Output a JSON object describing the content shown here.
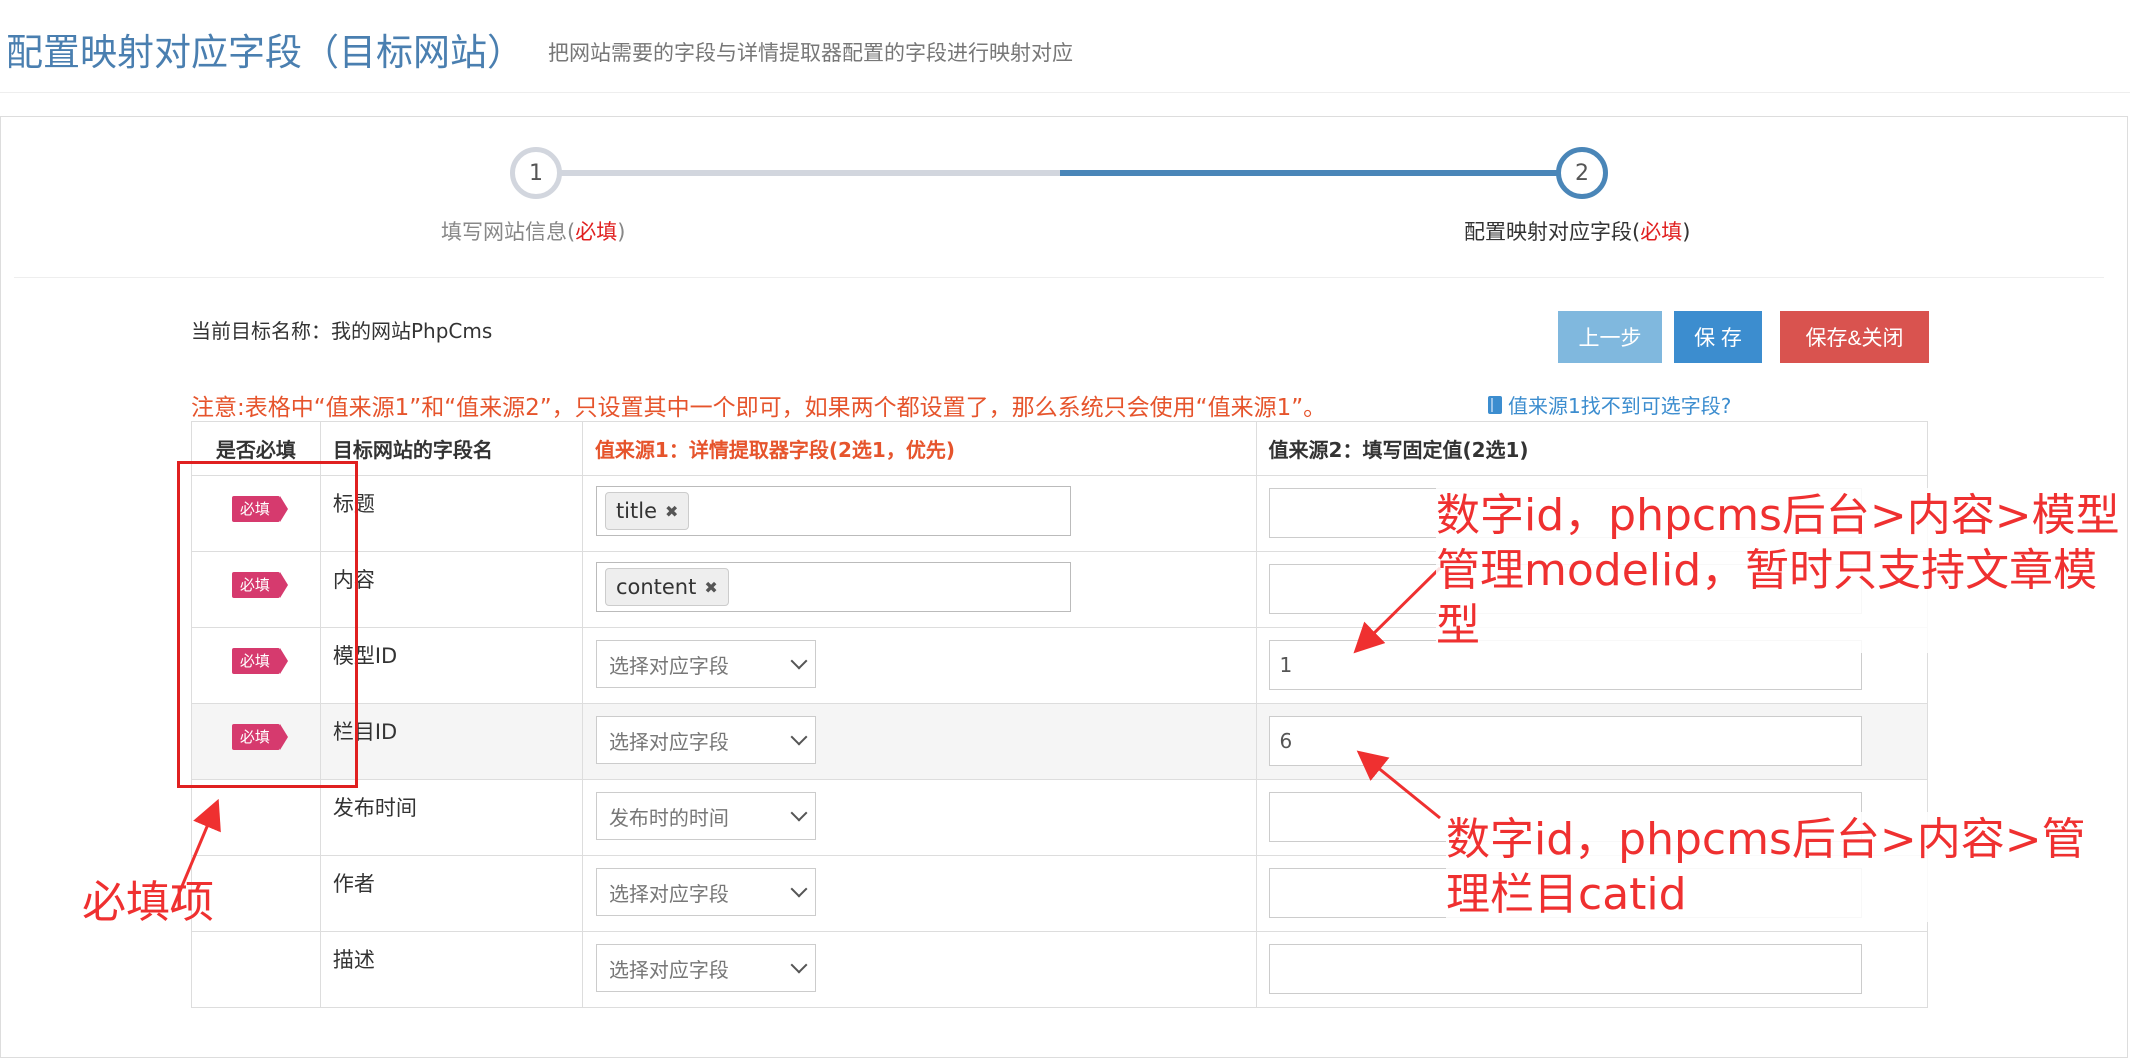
{
  "header": {
    "title": "配置映射对应字段（目标网站）",
    "subtitle": "把网站需要的字段与详情提取器配置的字段进行映射对应"
  },
  "wizard": {
    "steps": [
      {
        "number": "1",
        "label": "填写网站信息(",
        "required": "必填",
        "close": ")"
      },
      {
        "number": "2",
        "label": "配置映射对应字段(",
        "required": "必填",
        "close": ")"
      }
    ]
  },
  "target_name": "当前目标名称：我的网站PhpCms",
  "buttons": {
    "prev": "上一步",
    "save": "保 存",
    "save_close": "保存&关闭"
  },
  "notice": "注意:表格中“值来源1”和“值来源2”，只设置其中一个即可，如果两个都设置了，那么系统只会使用“值来源1”。",
  "help_link": "值来源1找不到可选字段?",
  "table": {
    "headers": {
      "required": "是否必填",
      "field": "目标网站的字段名",
      "source1": "值来源1：详情提取器字段(2选1，优先)",
      "source2": "值来源2：填写固定值(2选1)"
    },
    "rows": [
      {
        "required_badge": "必填",
        "name": "标题",
        "source1_tag": "title",
        "source2": ""
      },
      {
        "required_badge": "必填",
        "name": "内容",
        "source1_tag": "content",
        "source2": ""
      },
      {
        "required_badge": "必填",
        "name": "模型ID",
        "source1_select": "选择对应字段",
        "source2": "1"
      },
      {
        "required_badge": "必填",
        "name": "栏目ID",
        "source1_select": "选择对应字段",
        "source2": "6"
      },
      {
        "required_badge": "",
        "name": "发布时间",
        "source1_select": "发布时的时间",
        "source2": ""
      },
      {
        "required_badge": "",
        "name": "作者",
        "source1_select": "选择对应字段",
        "source2": ""
      },
      {
        "required_badge": "",
        "name": "描述",
        "source1_select": "选择对应字段",
        "source2": ""
      }
    ]
  },
  "annotations": {
    "model_note": "数字id，phpcms后台>内容>模型管理modelid，暂时只支持文章模型",
    "catid_note": "数字id，phpcms后台>内容>管理栏目catid",
    "required_note": "必填项"
  },
  "colors": {
    "accent": "#4a86b8",
    "danger": "#d9534f",
    "annotation": "#ef3030",
    "badge": "#d63a6e"
  }
}
